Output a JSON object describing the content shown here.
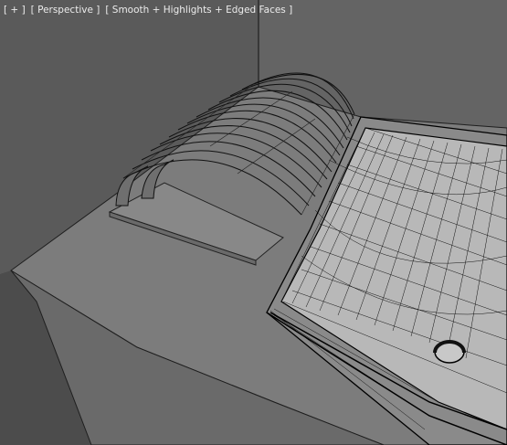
{
  "viewport": {
    "menus": [
      {
        "label": "[ + ]"
      },
      {
        "label": "[ Perspective ]"
      },
      {
        "label": "[ Smooth + Highlights + Edged Faces ]"
      }
    ]
  },
  "colors": {
    "background_wall": "#595959",
    "side_wall": "#4a4a4a",
    "counter_top": "#7f7f7f",
    "counter_front": "#6c6c6c",
    "wireframe": "#000000",
    "basin_inner": "#b9b9b9"
  },
  "scene": {
    "objects": [
      "back-wall",
      "right-wall",
      "counter-top",
      "counter-front",
      "curved-slat-tray",
      "sink-basin-wireframe",
      "drain-plug"
    ]
  }
}
